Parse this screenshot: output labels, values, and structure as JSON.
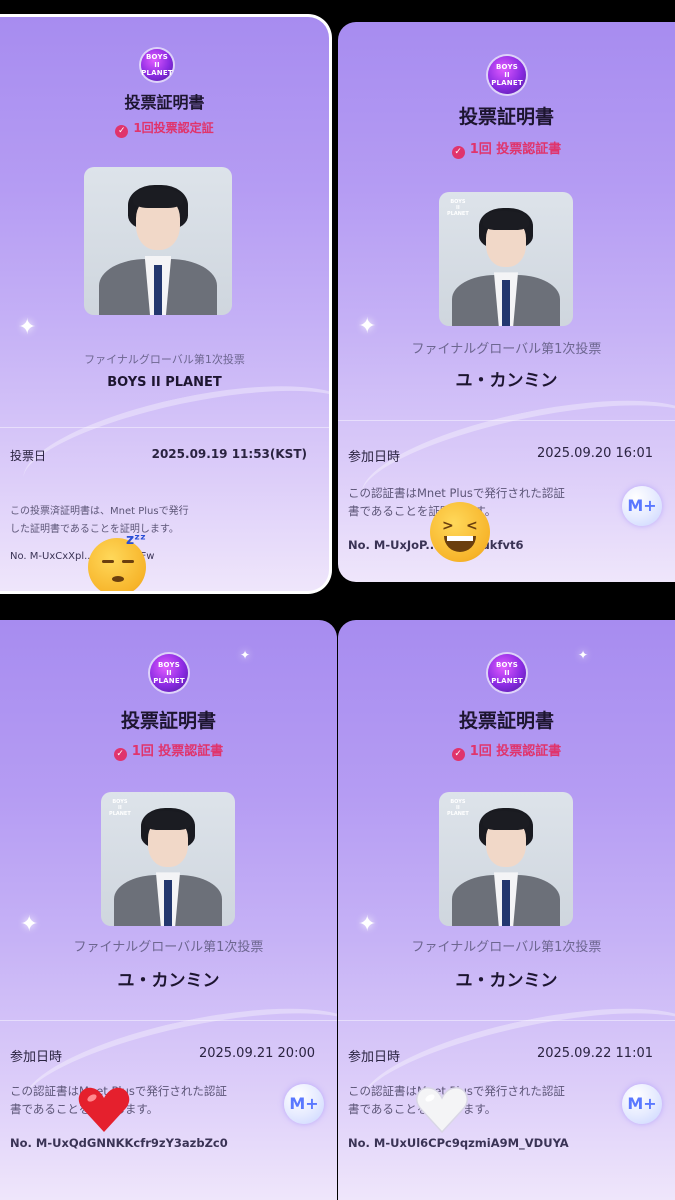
{
  "cards": [
    {
      "logo": [
        "BOYS",
        "II",
        "PLANET"
      ],
      "title": "投票証明書",
      "badge": "1回投票認定証",
      "subtitle": "ファイナルグローバル第1次投票",
      "name": "BOYS II PLANET",
      "date_label": "投票日",
      "date_value": "2025.09.19 11:53(KST)",
      "desc_line1": "この投票済証明書は、Mnet Plusで発行",
      "desc_line2": "した証明書であることを証明します。",
      "cert_no": "No. M-UxCxXpl...DLwtjd3vFw",
      "sticker": "sleepy-face-emoji"
    },
    {
      "logo": [
        "BOYS",
        "II",
        "PLANET"
      ],
      "title": "投票証明書",
      "badge": "1回 投票認証書",
      "subtitle": "ファイナルグローバル第1次投票",
      "name": "ユ・カンミン",
      "date_label": "参加日時",
      "date_value": "2025.09.20 16:01",
      "desc_line1": "この認証書はMnet Plusで発行された認証",
      "desc_line2": "書であることを証明します。",
      "cert_no": "No. M-UxJoP...ZKfGMukfvt6",
      "sticker": "grinning-squinting-face-emoji"
    },
    {
      "logo": [
        "BOYS",
        "II",
        "PLANET"
      ],
      "title": "投票証明書",
      "badge": "1回 投票認証書",
      "subtitle": "ファイナルグローバル第1次投票",
      "name": "ユ・カンミン",
      "date_label": "参加日時",
      "date_value": "2025.09.21 20:00",
      "desc_line1": "この認証書はMnet Plusで発行された認証",
      "desc_line2": "書であることを証明します。",
      "cert_no": "No. M-UxQdGNNKKcfr9zY3azbZc0",
      "sticker": "red-heart-emoji"
    },
    {
      "logo": [
        "BOYS",
        "II",
        "PLANET"
      ],
      "title": "投票証明書",
      "badge": "1回 投票認証書",
      "subtitle": "ファイナルグローバル第1次投票",
      "name": "ユ・カンミン",
      "date_label": "参加日時",
      "date_value": "2025.09.22 11:01",
      "desc_line1": "この認証書はMnet Plusで発行された認証",
      "desc_line2": "書であることを証明します。",
      "cert_no": "No. M-UxUl6CPc9qzmiA9M_VDUYA",
      "sticker": "white-heart-emoji"
    }
  ],
  "mnet_badge": "M+",
  "colors": {
    "accent": "#e0346c",
    "card_top": "#a78cf0",
    "card_bottom": "#efe6fb"
  }
}
